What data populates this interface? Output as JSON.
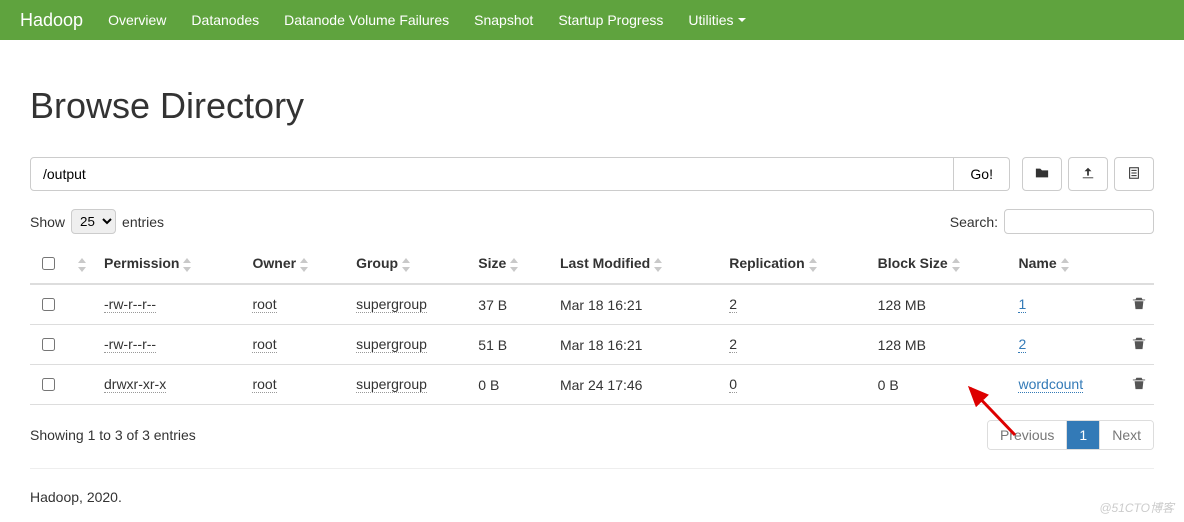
{
  "navbar": {
    "brand": "Hadoop",
    "items": [
      "Overview",
      "Datanodes",
      "Datanode Volume Failures",
      "Snapshot",
      "Startup Progress",
      "Utilities"
    ]
  },
  "page": {
    "title": "Browse Directory",
    "path_value": "/output",
    "go_label": "Go!"
  },
  "controls": {
    "show_label": "Show",
    "entries_label": "entries",
    "page_size": "25",
    "search_label": "Search:",
    "search_value": ""
  },
  "table": {
    "headers": [
      "",
      "",
      "Permission",
      "Owner",
      "Group",
      "Size",
      "Last Modified",
      "Replication",
      "Block Size",
      "Name",
      ""
    ],
    "rows": [
      {
        "permission": "-rw-r--r--",
        "owner": "root",
        "group": "supergroup",
        "size": "37 B",
        "modified": "Mar 18 16:21",
        "replication": "2",
        "block": "128 MB",
        "name": "1"
      },
      {
        "permission": "-rw-r--r--",
        "owner": "root",
        "group": "supergroup",
        "size": "51 B",
        "modified": "Mar 18 16:21",
        "replication": "2",
        "block": "128 MB",
        "name": "2"
      },
      {
        "permission": "drwxr-xr-x",
        "owner": "root",
        "group": "supergroup",
        "size": "0 B",
        "modified": "Mar 24 17:46",
        "replication": "0",
        "block": "0 B",
        "name": "wordcount"
      }
    ]
  },
  "footer": {
    "info": "Showing 1 to 3 of 3 entries",
    "prev": "Previous",
    "next": "Next",
    "current_page": "1",
    "copyright": "Hadoop, 2020."
  },
  "watermark": "@51CTO博客"
}
